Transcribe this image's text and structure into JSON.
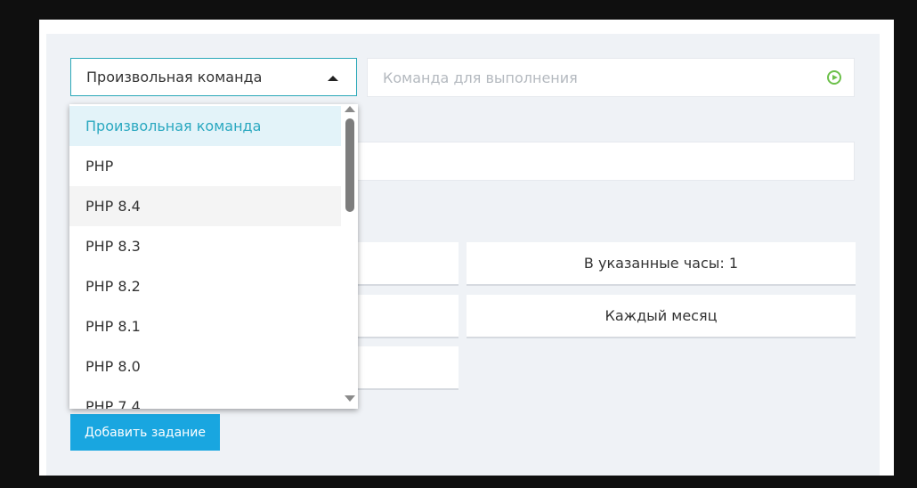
{
  "command_type": {
    "selected": "Произвольная команда",
    "options": [
      "Произвольная команда",
      "PHP",
      "PHP 8.4",
      "PHP 8.3",
      "PHP 8.2",
      "PHP 8.1",
      "PHP 8.0",
      "PHP 7.4"
    ]
  },
  "command_input": {
    "placeholder": "Команда для выполнения"
  },
  "schedule": {
    "hours_label": "В указанные часы: 1",
    "monthly_label": "Каждый месяц"
  },
  "actions": {
    "add_task_label": "Добавить задание"
  },
  "colors": {
    "accent": "#19a6e0",
    "select_border": "#2aa8b8",
    "run_icon": "#6cc04a"
  }
}
